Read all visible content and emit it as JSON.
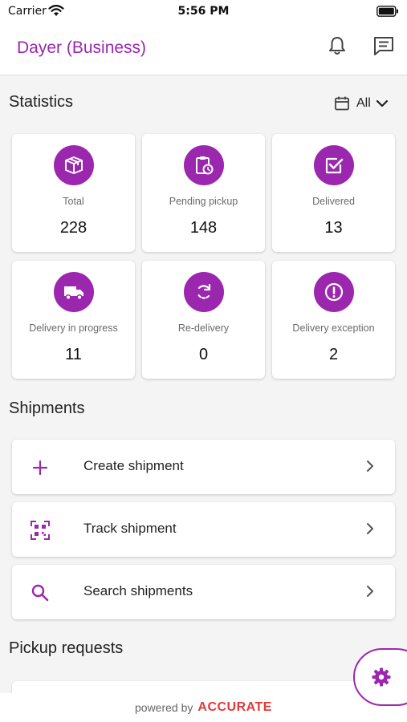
{
  "status_bar": {
    "carrier": "Carrier",
    "time": "5:56 PM"
  },
  "header": {
    "title": "Dayer (Business)"
  },
  "statistics": {
    "title": "Statistics",
    "filter_label": "All",
    "cards": [
      {
        "label": "Total",
        "value": "228",
        "icon": "package-icon"
      },
      {
        "label": "Pending pickup",
        "value": "148",
        "icon": "clipboard-clock-icon"
      },
      {
        "label": "Delivered",
        "value": "13",
        "icon": "check-square-icon"
      },
      {
        "label": "Delivery in progress",
        "value": "11",
        "icon": "truck-icon"
      },
      {
        "label": "Re-delivery",
        "value": "0",
        "icon": "refresh-icon"
      },
      {
        "label": "Delivery exception",
        "value": "2",
        "icon": "alert-circle-icon"
      }
    ]
  },
  "shipments": {
    "title": "Shipments",
    "items": [
      {
        "label": "Create shipment",
        "icon": "plus-icon"
      },
      {
        "label": "Track shipment",
        "icon": "qr-scan-icon"
      },
      {
        "label": "Search shipments",
        "icon": "search-icon"
      }
    ]
  },
  "pickup": {
    "title": "Pickup requests"
  },
  "footer": {
    "powered_text": "powered by",
    "brand": "ACCURATE"
  },
  "colors": {
    "accent": "#9b27af",
    "brand": "#e23a3a"
  }
}
